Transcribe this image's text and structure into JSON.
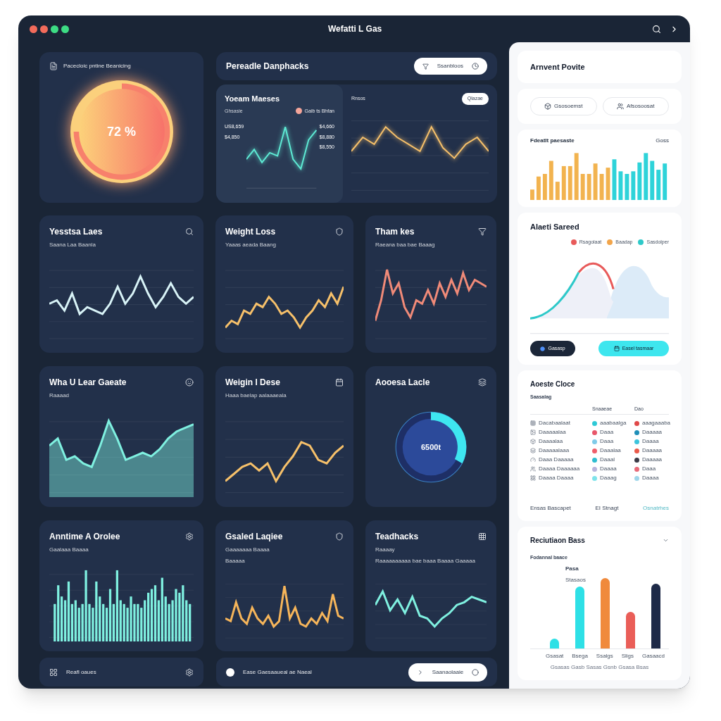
{
  "window": {
    "title": "Wefatti L Gas"
  },
  "donut_card": {
    "title": "Pacecloic pntine Beanicing",
    "center": "72 %"
  },
  "overview": {
    "title": "Pereadle Danphacks",
    "button": "Ssanbloos",
    "panel": {
      "title": "Yoeam Maeses",
      "subtitle": "Ghsasie",
      "legend": "Gaib ts Bhfan",
      "left_values": [
        "US8,659",
        "$4,850"
      ],
      "right_values": [
        "$4,660",
        "$8,880",
        "$8,550"
      ]
    },
    "side": {
      "label": "Rnsos",
      "button": "Qlazae"
    }
  },
  "cards": [
    {
      "title": "Yesstsa Laes",
      "subtitle": "Saana Laa Baanla",
      "kind": "line",
      "color": "#d8f3f7"
    },
    {
      "title": "Weight Loss",
      "subtitle": "Yaaas aeada Baang",
      "kind": "line",
      "color": "#f6c06a"
    },
    {
      "title": "Tham kes",
      "subtitle": "Raeana baa bae Baaag",
      "kind": "line",
      "color": "#f08a78"
    },
    {
      "title": "Wha U Lear Gaeate",
      "subtitle": "Raaaad",
      "kind": "area",
      "color": "#7ff0e0"
    },
    {
      "title": "Weigin I Dese",
      "subtitle": "Haaa baelap aalaaaeala",
      "kind": "line",
      "color": "#f6c06a"
    },
    {
      "title": "Aooesa Lacle",
      "kind": "gauge",
      "color": "#3ee6f0",
      "center": "6500t"
    },
    {
      "title": "Anntime A Orolee",
      "subtitle": "Gaalaaa Baaaa",
      "kind": "bars",
      "color": "#7ff0e0"
    },
    {
      "title": "Gsaled Laqiee",
      "subtitle": "Gaaaaaaa Baaaa",
      "note": "Baaaaa",
      "kind": "line",
      "color": "#f6b55a"
    },
    {
      "title": "Teadhacks",
      "subtitle": "Raaaay",
      "note": "Raaaaaaaaaa bae baaa Baaaa Gaaaaa",
      "kind": "line",
      "color": "#7ff0e0"
    }
  ],
  "footer": {
    "left": "Reafl oaues",
    "middle": "Ease Gaesaaueal ae Naeal",
    "button": "Saanaolaaie"
  },
  "side_panel": {
    "title": "Arnvent Povite",
    "buttons": [
      "Gsosoemst",
      "Afsosoosat"
    ],
    "bar_card": {
      "title": "Fdeatlt paesaste",
      "badge": "Goss"
    },
    "area_card": {
      "title": "Alaeti Sareed",
      "legend": [
        {
          "label": "Rsagolaat",
          "color": "#e85a5a"
        },
        {
          "label": "Baadap",
          "color": "#f2a54a"
        },
        {
          "label": "Sasdolper",
          "color": "#2ec9c9"
        }
      ],
      "buttons": [
        "Gasasp",
        "Easel tasmaar"
      ]
    },
    "table": {
      "title": "Aoeste Cloce",
      "subtitle": "Saasalag",
      "columns": [
        "Snaaeae",
        "Dao"
      ],
      "rows": [
        {
          "name": "Dacabaalaat",
          "status": {
            "text": "aaabaalga",
            "color": "#2ec9d6"
          },
          "value": {
            "text": "aaagaaaba",
            "color": "#e04848"
          }
        },
        {
          "name": "Daaaaalaa",
          "status": {
            "text": "Daaa",
            "color": "#e8576a"
          },
          "value": {
            "text": "Daaaaa",
            "color": "#1f8fb8"
          }
        },
        {
          "name": "Daaaalaa",
          "status": {
            "text": "Daaa",
            "color": "#7fcbe8"
          },
          "value": {
            "text": "Daaaa",
            "color": "#3cc4dc"
          }
        },
        {
          "name": "Daaaaalaaa",
          "status": {
            "text": "Daaalaa",
            "color": "#ef5e6a"
          },
          "value": {
            "text": "Daaaaa",
            "color": "#ea5a4a"
          }
        },
        {
          "name": "Daaa Daaaaa",
          "status": {
            "text": "Daaal",
            "color": "#2ebdd0"
          },
          "value": {
            "text": "Daaaaa",
            "color": "#3a3a46"
          }
        },
        {
          "name": "Daaaa Daaaaaa",
          "status": {
            "text": "Daaaa",
            "color": "#b9b4dc"
          },
          "value": {
            "text": "Daaa",
            "color": "#e86a78"
          }
        },
        {
          "name": "Daaaa Daaaa",
          "status": {
            "text": "Daaag",
            "color": "#7fe3ea"
          },
          "value": {
            "text": "Daaaa",
            "color": "#9fd6ea"
          }
        }
      ],
      "footer": [
        "Ensas Bascapet",
        "EI Stnagt",
        "Osnatrhes"
      ]
    },
    "column_card": {
      "title": "Reciutiaon Bass",
      "subtitle": "Fodannal baace",
      "peak_label": "Pasa",
      "peak_sub": "Stasaos",
      "bars": [
        {
          "label": "Gsasat",
          "color": "#2ee0e6"
        },
        {
          "label": "Bsega",
          "color": "#2ee0e6"
        },
        {
          "label": "Ssalgs",
          "color": "#f08a3c"
        },
        {
          "label": "Sligs",
          "color": "#ea5e58"
        },
        {
          "label": "Gasaacd",
          "color": "#1e2a48"
        }
      ],
      "caption": "Gsasas Gasb Sasas Gsnb Gsasa Bsas"
    }
  }
}
